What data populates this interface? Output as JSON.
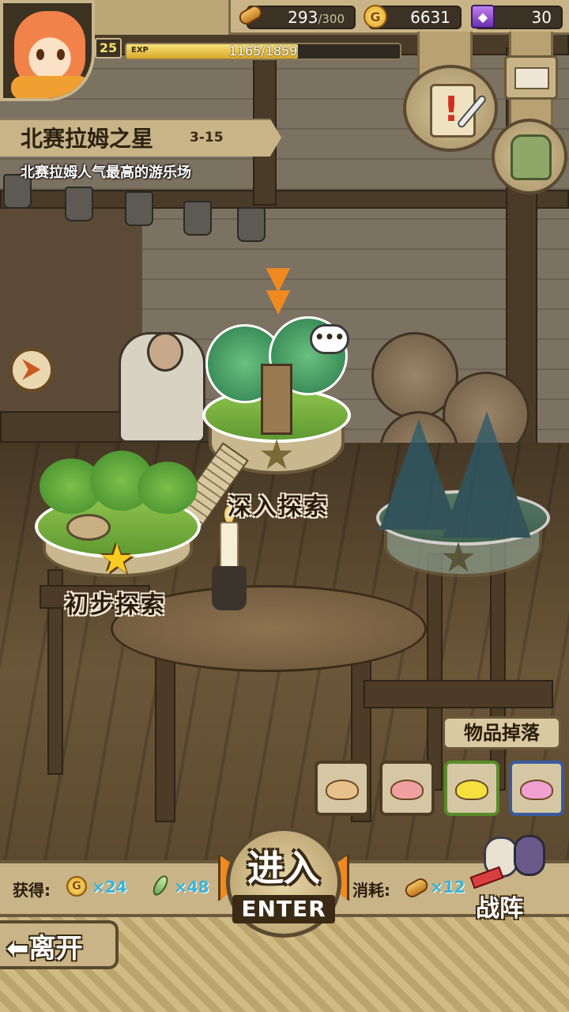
{
  "resources": {
    "stamina": "293",
    "stamina_max": "/300",
    "gold": "6631",
    "gold_icon": "G",
    "gems": "30"
  },
  "player": {
    "level": "25",
    "exp_label": "EXP",
    "exp_text": "1165/1859",
    "exp_progress": 0.627
  },
  "stage": {
    "name": "北赛拉姆之星",
    "number": "3-15",
    "description": "北赛拉姆人气最高的游乐场"
  },
  "islands": {
    "easy_label": "初步探索",
    "deep_label": "深入探索",
    "speech_bubble": "•••"
  },
  "drops": {
    "title": "物品掉落",
    "items": [
      {
        "name": "tan-blob",
        "color": "#e8c08a",
        "border": "#4c3c24"
      },
      {
        "name": "pink-blob",
        "color": "#f0a0a0",
        "border": "#4c3c24"
      },
      {
        "name": "yellow-blob",
        "color": "#f5e040",
        "border": "#5a8a2a"
      },
      {
        "name": "magenta-blob",
        "color": "#f0a0d0",
        "border": "#3a5aa0"
      }
    ]
  },
  "bottom": {
    "gain_label": "获得:",
    "gain_gold": "×24",
    "gain_feather": "×48",
    "cost_label": "消耗:",
    "cost_stamina": "×12",
    "enter_cn": "进入",
    "enter_en": "ENTER",
    "formation": "战阵",
    "leave": "离开"
  },
  "colors": {
    "accent_orange": "#f08a20",
    "panel_tan": "#c8b487",
    "value_cyan": "#38b4d8"
  }
}
